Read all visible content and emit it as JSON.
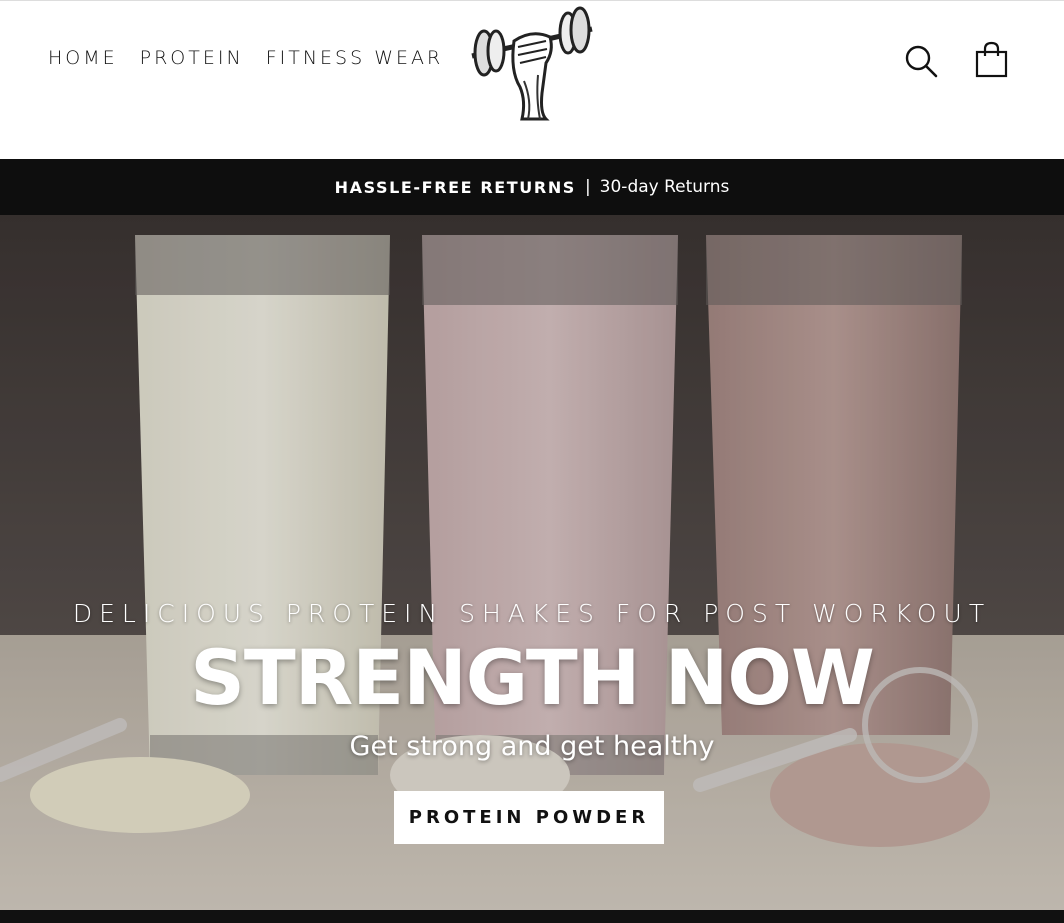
{
  "header": {
    "nav": [
      "HOME",
      "PROTEIN",
      "FITNESS WEAR"
    ],
    "logo_icon": "dumbbell-fist-logo",
    "search_icon": "search-icon",
    "cart_icon": "shopping-bag-icon"
  },
  "announcement": {
    "bold": "HASSLE-FREE RETURNS",
    "separator": "|",
    "text": "30-day Returns"
  },
  "hero": {
    "subheading": "DELICIOUS PROTEIN SHAKES FOR POST WORKOUT",
    "title": "STRENGTH NOW",
    "text": "Get strong and get healthy",
    "button_label": "PROTEIN POWDER"
  },
  "colors": {
    "announcement_bg": "#0e0e0e",
    "accent": "#ffffff"
  }
}
